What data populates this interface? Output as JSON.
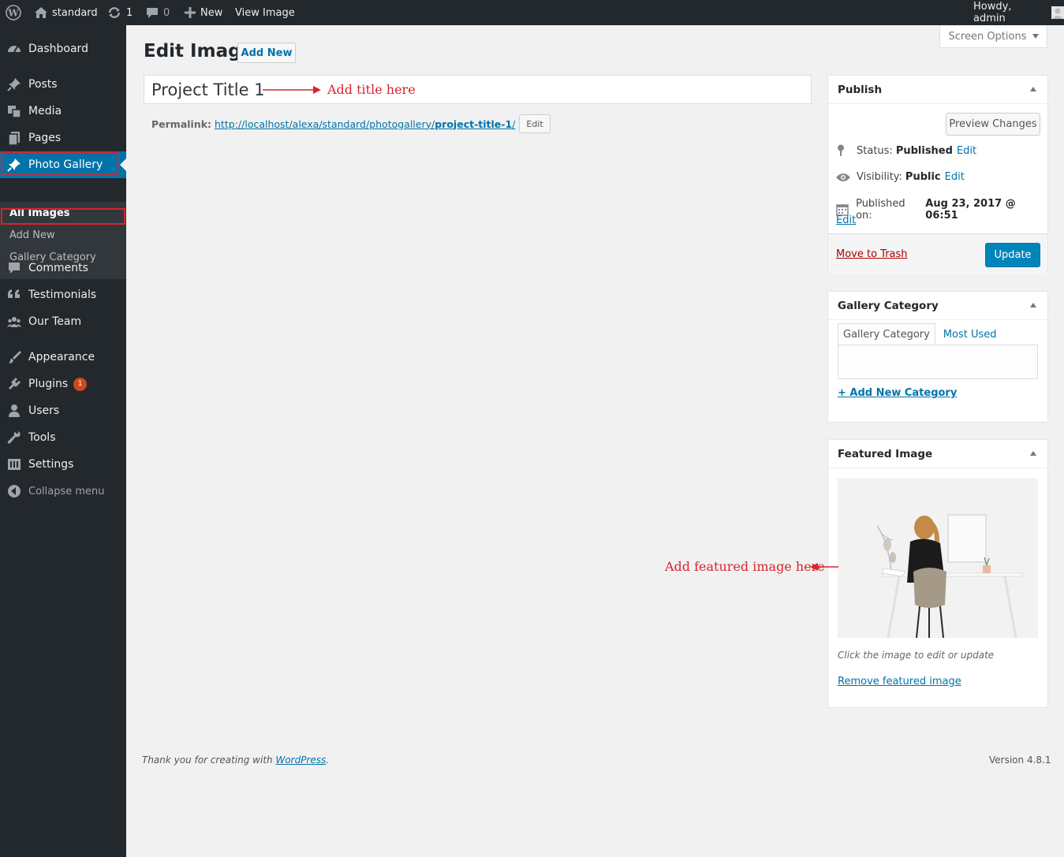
{
  "admin_bar": {
    "site_name": "standard",
    "updates_count": "1",
    "comments_count": "0",
    "new_label": "New",
    "view_label": "View Image",
    "greeting": "Howdy, admin"
  },
  "sidebar": {
    "items": [
      {
        "label": "Dashboard",
        "icon": "dashboard-icon"
      },
      {
        "label": "Posts",
        "icon": "pin-icon"
      },
      {
        "label": "Media",
        "icon": "media-icon"
      },
      {
        "label": "Pages",
        "icon": "pages-icon"
      },
      {
        "label": "Photo Gallery",
        "icon": "pin-icon"
      },
      {
        "label": "Comments",
        "icon": "comment-icon"
      },
      {
        "label": "Testimonials",
        "icon": "quote-icon"
      },
      {
        "label": "Our Team",
        "icon": "groups-icon"
      },
      {
        "label": "Appearance",
        "icon": "brush-icon"
      },
      {
        "label": "Plugins",
        "icon": "plugin-icon"
      },
      {
        "label": "Users",
        "icon": "user-icon"
      },
      {
        "label": "Tools",
        "icon": "wrench-icon"
      },
      {
        "label": "Settings",
        "icon": "settings-icon"
      },
      {
        "label": "Collapse menu",
        "icon": "collapse-icon"
      }
    ],
    "plugins_badge": "1",
    "submenu": [
      "All Images",
      "Add New",
      "Gallery Category"
    ]
  },
  "header": {
    "title": "Edit Image",
    "add_new": "Add New",
    "screen_options": "Screen Options"
  },
  "editor": {
    "title_value": "Project Title 1",
    "title_annotation": "Add title here",
    "permalink_label": "Permalink:",
    "permalink_base": "http://localhost/alexa/standard/photogallery/",
    "permalink_slug": "project-title-1",
    "permalink_trail": "/",
    "permalink_edit": "Edit"
  },
  "publish": {
    "heading": "Publish",
    "preview": "Preview Changes",
    "status_label": "Status:",
    "status_value": "Published",
    "visibility_label": "Visibility:",
    "visibility_value": "Public",
    "published_label": "Published on:",
    "published_value": "Aug 23, 2017 @ 06:51",
    "edit": "Edit",
    "trash": "Move to Trash",
    "update": "Update"
  },
  "gallery_category": {
    "heading": "Gallery Category",
    "tab_all": "Gallery Category",
    "tab_used": "Most Used",
    "add_new": "+ Add New Category"
  },
  "featured_image": {
    "heading": "Featured Image",
    "caption": "Click the image to edit or update",
    "remove": "Remove featured image",
    "annotation": "Add featured image here"
  },
  "footer": {
    "thanks_prefix": "Thank you for creating with ",
    "wp_link": "WordPress",
    "thanks_suffix": ".",
    "version": "Version 4.8.1"
  },
  "colors": {
    "sidebar_bg": "#23282d",
    "accent": "#0073aa",
    "annotation": "#d9232d",
    "update_button": "#0085ba"
  }
}
